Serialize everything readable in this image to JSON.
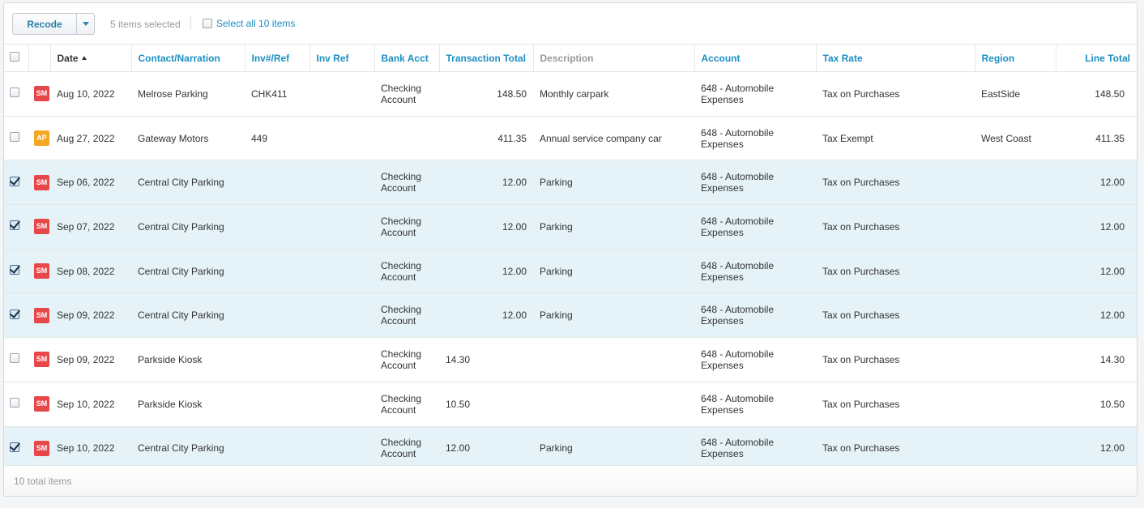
{
  "toolbar": {
    "recode_label": "Recode",
    "selected_text": "5 items selected",
    "select_all_label": "Select all 10 items"
  },
  "columns": {
    "date": "Date",
    "contact": "Contact/Narration",
    "invref": "Inv#/Ref",
    "invref2": "Inv Ref",
    "bank": "Bank Acct",
    "total": "Transaction Total",
    "desc": "Description",
    "account": "Account",
    "tax": "Tax Rate",
    "region": "Region",
    "line": "Line Total"
  },
  "badge_colors": {
    "SM": "#e8474a",
    "AP": "#f5a623"
  },
  "rows": [
    {
      "checked": false,
      "badge": "SM",
      "date": "Aug 10, 2022",
      "contact": "Melrose Parking",
      "invref": "CHK411",
      "invref2": "",
      "bank1": "Checking",
      "bank2": "Account",
      "total": "148.50",
      "desc": "Monthly carpark",
      "acct1": "648 - Automobile",
      "acct2": "Expenses",
      "tax": "Tax on Purchases",
      "region": "EastSide",
      "line": "148.50"
    },
    {
      "checked": false,
      "badge": "AP",
      "date": "Aug 27, 2022",
      "contact": "Gateway Motors",
      "invref": "449",
      "invref2": "",
      "bank1": "",
      "bank2": "",
      "total": "411.35",
      "desc": "Annual service company car",
      "acct1": "648 - Automobile",
      "acct2": "Expenses",
      "tax": "Tax Exempt",
      "region": "West Coast",
      "line": "411.35"
    },
    {
      "checked": true,
      "badge": "SM",
      "date": "Sep 06, 2022",
      "contact": "Central City Parking",
      "invref": "",
      "invref2": "",
      "bank1": "Checking",
      "bank2": "Account",
      "total": "12.00",
      "desc": "Parking",
      "acct1": "648 - Automobile",
      "acct2": "Expenses",
      "tax": "Tax on Purchases",
      "region": "",
      "line": "12.00"
    },
    {
      "checked": true,
      "badge": "SM",
      "date": "Sep 07, 2022",
      "contact": "Central City Parking",
      "invref": "",
      "invref2": "",
      "bank1": "Checking",
      "bank2": "Account",
      "total": "12.00",
      "desc": "Parking",
      "acct1": "648 - Automobile",
      "acct2": "Expenses",
      "tax": "Tax on Purchases",
      "region": "",
      "line": "12.00"
    },
    {
      "checked": true,
      "badge": "SM",
      "date": "Sep 08, 2022",
      "contact": "Central City Parking",
      "invref": "",
      "invref2": "",
      "bank1": "Checking",
      "bank2": "Account",
      "total": "12.00",
      "desc": "Parking",
      "acct1": "648 - Automobile",
      "acct2": "Expenses",
      "tax": "Tax on Purchases",
      "region": "",
      "line": "12.00"
    },
    {
      "checked": true,
      "badge": "SM",
      "date": "Sep 09, 2022",
      "contact": "Central City Parking",
      "invref": "",
      "invref2": "",
      "bank1": "Checking",
      "bank2": "Account",
      "total": "12.00",
      "desc": "Parking",
      "acct1": "648 - Automobile",
      "acct2": "Expenses",
      "tax": "Tax on Purchases",
      "region": "",
      "line": "12.00"
    },
    {
      "checked": false,
      "badge": "SM",
      "date": "Sep 09, 2022",
      "contact": "Parkside Kiosk",
      "invref": "",
      "invref2": "",
      "bank1": "Checking",
      "bank2": "Account",
      "total": "14.30",
      "desc": "",
      "acct1": "648 - Automobile",
      "acct2": "Expenses",
      "tax": "Tax on Purchases",
      "region": "",
      "line": "14.30"
    },
    {
      "checked": false,
      "badge": "SM",
      "date": "Sep 10, 2022",
      "contact": "Parkside Kiosk",
      "invref": "",
      "invref2": "",
      "bank1": "Checking",
      "bank2": "Account",
      "total": "10.50",
      "desc": "",
      "acct1": "648 - Automobile",
      "acct2": "Expenses",
      "tax": "Tax on Purchases",
      "region": "",
      "line": "10.50"
    },
    {
      "checked": true,
      "badge": "SM",
      "date": "Sep 10, 2022",
      "contact": "Central City Parking",
      "invref": "",
      "invref2": "",
      "bank1": "Checking",
      "bank2": "Account",
      "total": "12.00",
      "desc": "Parking",
      "acct1": "648 - Automobile",
      "acct2": "Expenses",
      "tax": "Tax on Purchases",
      "region": "",
      "line": "12.00"
    }
  ],
  "footer": {
    "total_items": "10 total items"
  }
}
